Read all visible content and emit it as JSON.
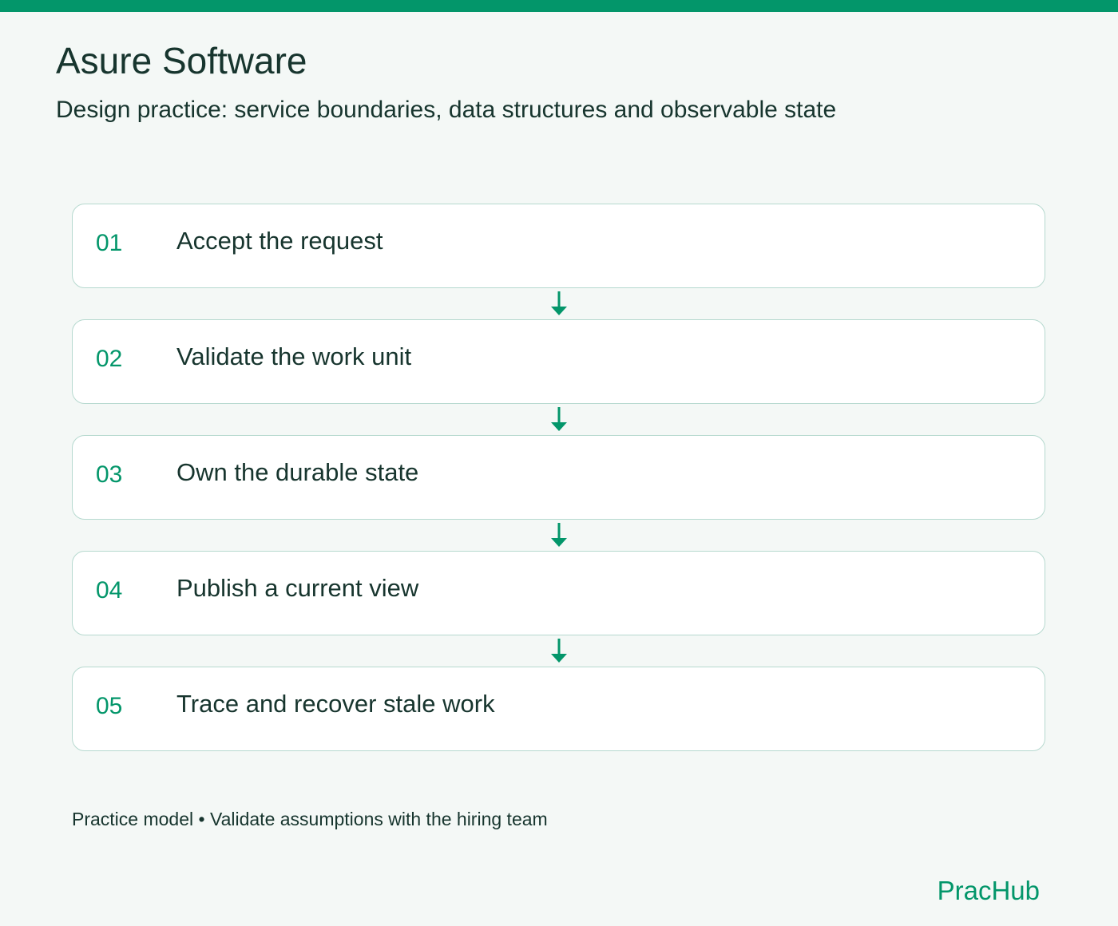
{
  "header": {
    "title": "Asure Software",
    "subtitle": "Design practice: service boundaries, data structures and observable state"
  },
  "steps": [
    {
      "number": "01",
      "label": "Accept the request"
    },
    {
      "number": "02",
      "label": "Validate the work unit"
    },
    {
      "number": "03",
      "label": "Own the durable state"
    },
    {
      "number": "04",
      "label": "Publish a current view"
    },
    {
      "number": "05",
      "label": "Trace and recover stale work"
    }
  ],
  "footer": {
    "note": "Practice model • Validate assumptions with the hiring team",
    "brand": "PracHub"
  },
  "colors": {
    "accent": "#03966a",
    "text": "#17352e",
    "background": "#f4f8f6",
    "card_border": "#b6d9cf",
    "card_background": "#ffffff"
  },
  "icons": {
    "connector": "arrow-down-icon"
  }
}
